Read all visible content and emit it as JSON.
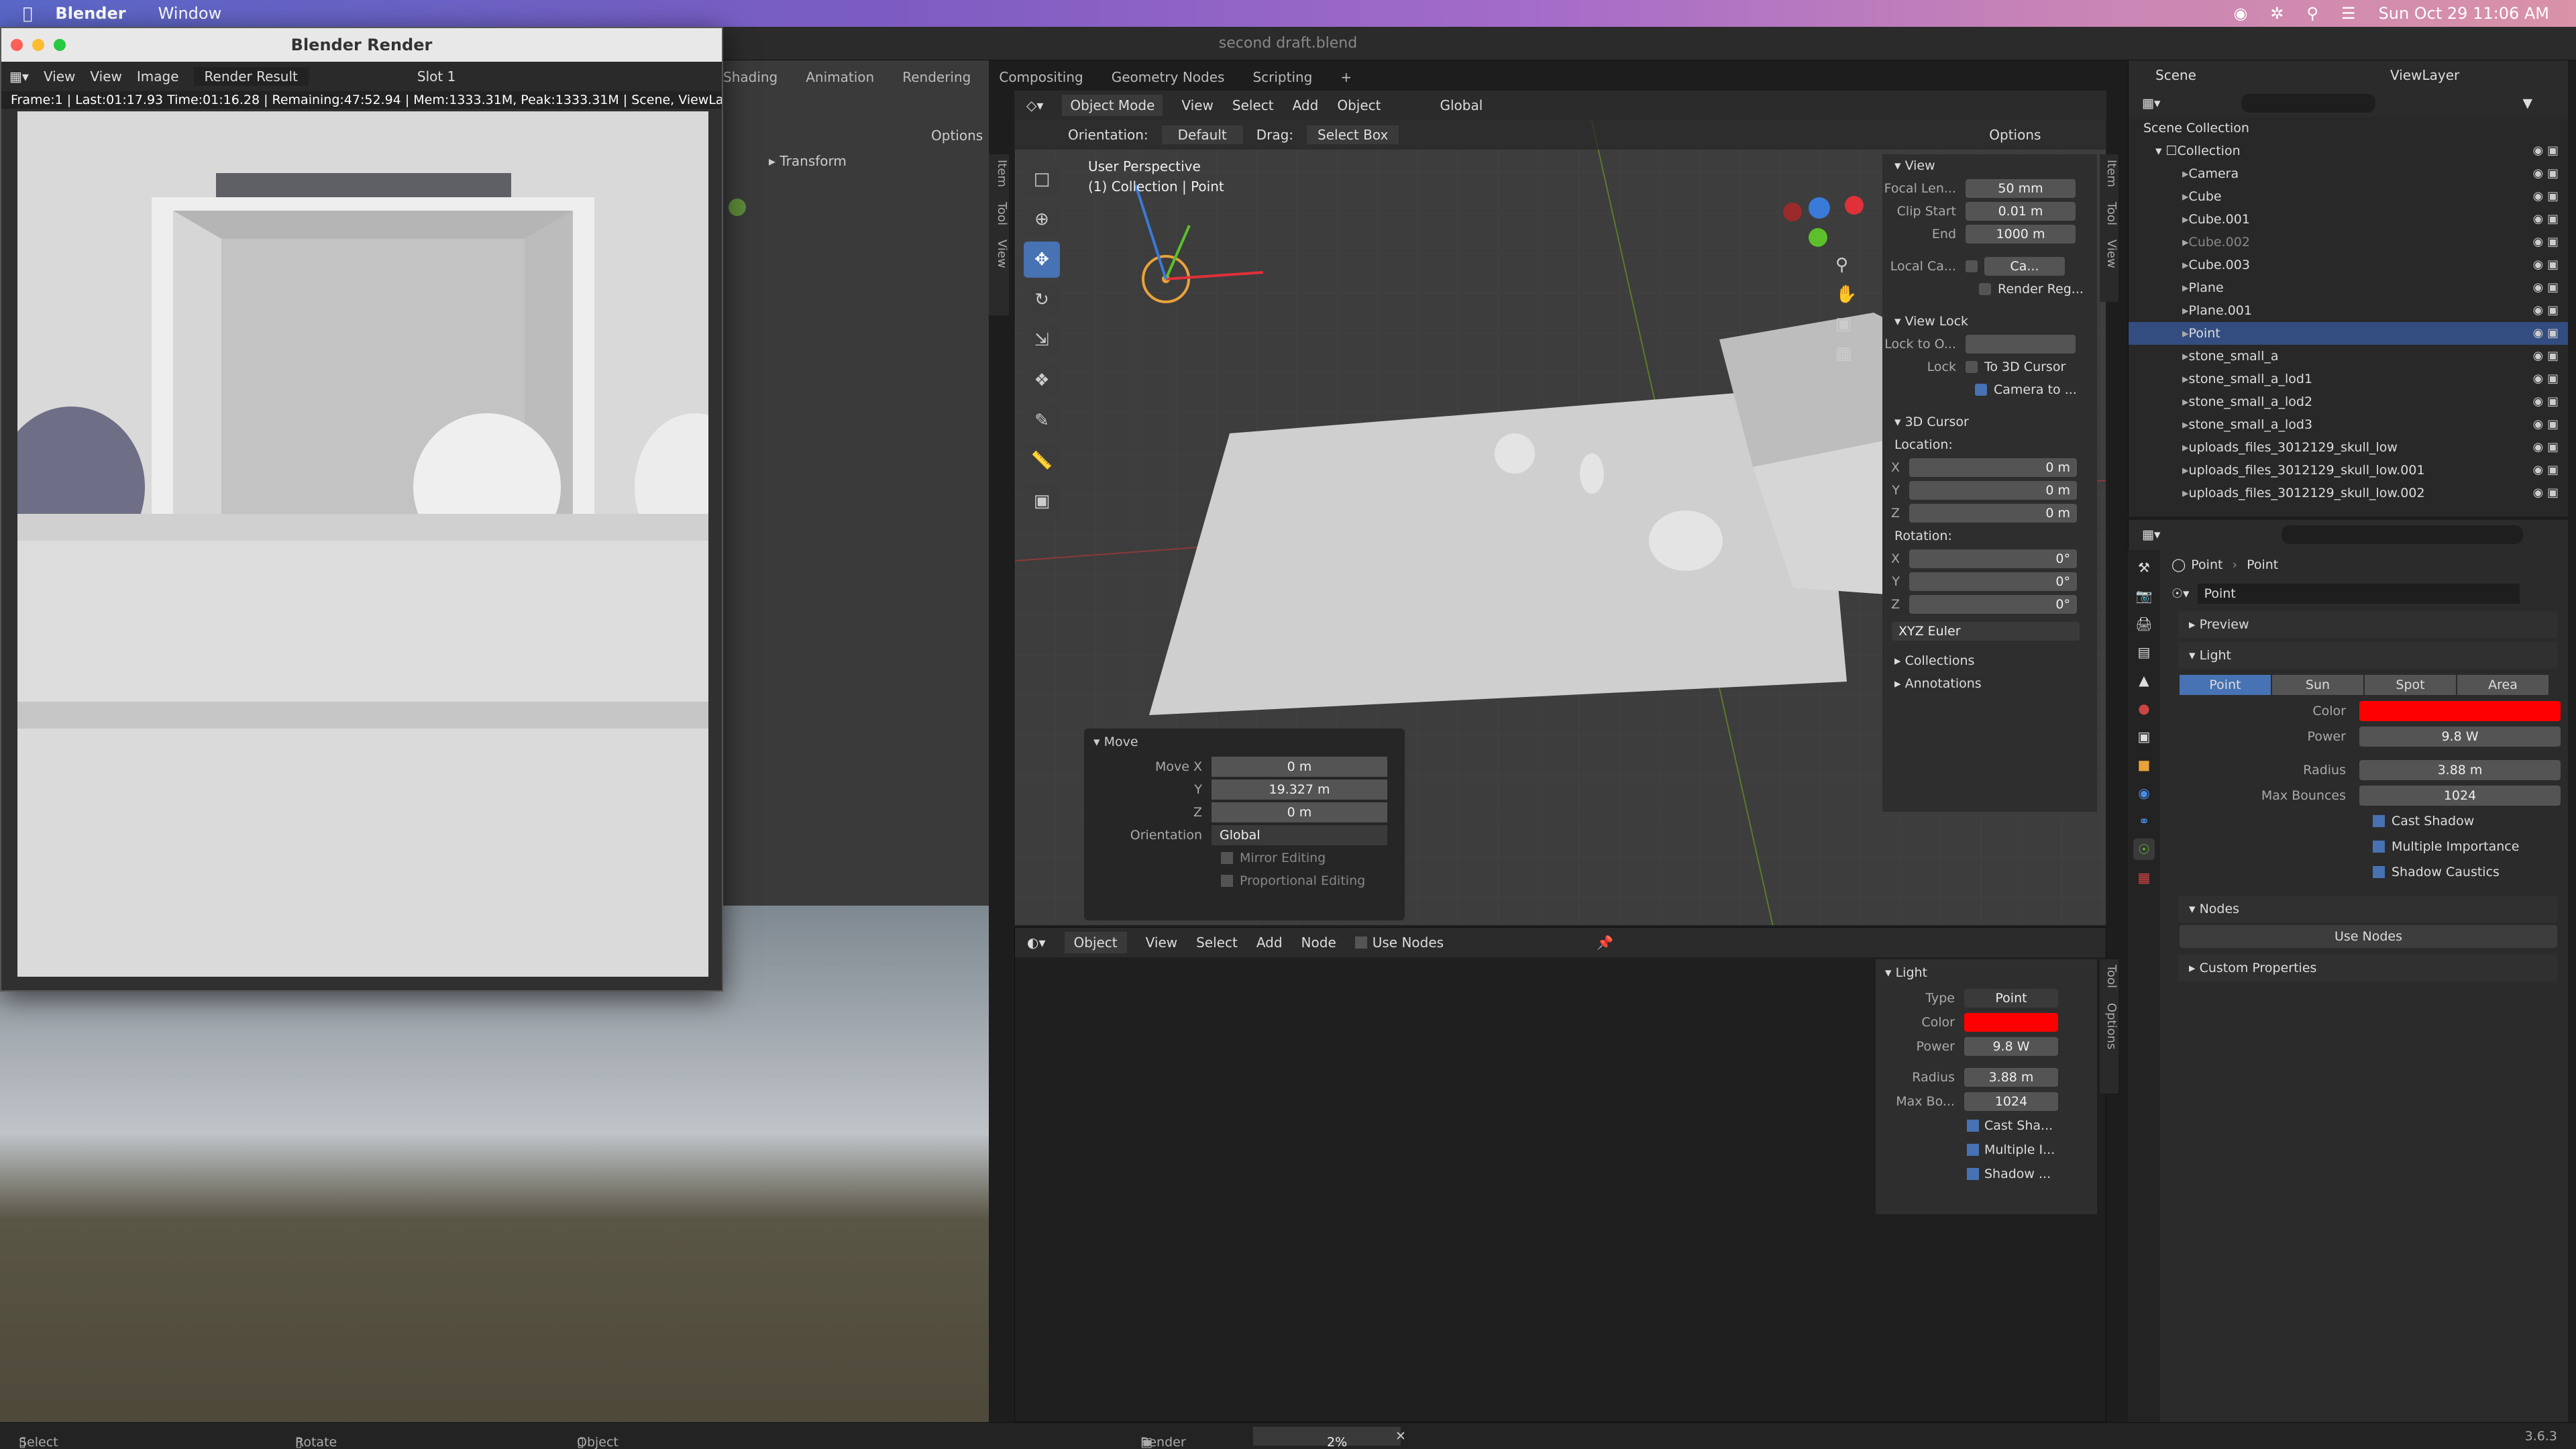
{
  "menubar": {
    "app": "Blender",
    "menu": "Window",
    "datetime": "Sun Oct 29  11:06 AM"
  },
  "titlebar": {
    "title": "second draft.blend"
  },
  "render_window": {
    "title": "Blender Render",
    "menu": [
      "View",
      "View",
      "Image"
    ],
    "image_name": "Render Result",
    "slot": "Slot 1",
    "status": "Frame:1 | Last:01:17.93 Time:01:16.28 | Remaining:47:52.94 | Mem:1333.31M, Peak:1333.31M | Scene, ViewLaye"
  },
  "left_panel": {
    "options": "Options",
    "transform": "Transform",
    "tabs": [
      "Item",
      "Tool",
      "View"
    ]
  },
  "workspaces": [
    "Shading",
    "Animation",
    "Rendering",
    "Compositing",
    "Geometry Nodes",
    "Scripting"
  ],
  "viewport": {
    "mode": "Object Mode",
    "menus": [
      "View",
      "Select",
      "Add",
      "Object"
    ],
    "transform_orientation": "Global",
    "orientation_label": "Orientation:",
    "orientation_value": "Default",
    "drag_label": "Drag:",
    "drag_value": "Select Box",
    "options": "Options",
    "overlay_title": "User Perspective",
    "overlay_sub": "(1) Collection | Point",
    "side_tabs": [
      "Item",
      "Tool",
      "View"
    ]
  },
  "npanel": {
    "view_header": "View",
    "focal_label": "Focal Len...",
    "focal_value": "50 mm",
    "clip_start_label": "Clip Start",
    "clip_start_value": "0.01 m",
    "end_label": "End",
    "end_value": "1000 m",
    "local_camera_label": "Local Ca...",
    "local_camera_value": "Ca...",
    "render_region": "Render Reg...",
    "view_lock_header": "View Lock",
    "lock_obj_label": "Lock to O...",
    "lock_label": "Lock",
    "to_3d_cursor": "To 3D Cursor",
    "camera_to": "Camera to ...",
    "cursor_header": "3D Cursor",
    "location_label": "Location:",
    "loc_x": "0 m",
    "loc_y": "0 m",
    "loc_z": "0 m",
    "rotation_label": "Rotation:",
    "rot_x": "0°",
    "rot_y": "0°",
    "rot_z": "0°",
    "rot_mode": "XYZ Euler",
    "collections": "Collections",
    "annotations": "Annotations"
  },
  "move_panel": {
    "title": "Move",
    "move_x_label": "Move X",
    "move_x": "0 m",
    "y_label": "Y",
    "move_y": "19.327 m",
    "z_label": "Z",
    "move_z": "0 m",
    "orientation_label": "Orientation",
    "orientation_value": "Global",
    "mirror": "Mirror Editing",
    "proportional": "Proportional Editing"
  },
  "shader": {
    "type": "Object",
    "menus": [
      "View",
      "Select",
      "Add",
      "Node"
    ],
    "use_nodes": "Use Nodes",
    "side_tabs": [
      "Tool",
      "Options"
    ],
    "light_header": "Light",
    "type_label": "Type",
    "type_value": "Point",
    "color_label": "Color",
    "power_label": "Power",
    "power_value": "9.8 W",
    "radius_label": "Radius",
    "radius_value": "3.88 m",
    "max_bounces_label": "Max Bo...",
    "max_bounces_value": "1024",
    "cast_shadow": "Cast Sha...",
    "multiple_imp": "Multiple I...",
    "shadow_caustics": "Shadow ..."
  },
  "outliner": {
    "scene": "Scene",
    "view_layer": "ViewLayer",
    "root": "Scene Collection",
    "collection": "Collection",
    "items": [
      {
        "name": "Camera"
      },
      {
        "name": "Cube"
      },
      {
        "name": "Cube.001"
      },
      {
        "name": "Cube.002"
      },
      {
        "name": "Cube.003"
      },
      {
        "name": "Plane"
      },
      {
        "name": "Plane.001"
      },
      {
        "name": "Point"
      },
      {
        "name": "stone_small_a"
      },
      {
        "name": "stone_small_a_lod1"
      },
      {
        "name": "stone_small_a_lod2"
      },
      {
        "name": "stone_small_a_lod3"
      },
      {
        "name": "uploads_files_3012129_skull_low"
      },
      {
        "name": "uploads_files_3012129_skull_low.001"
      },
      {
        "name": "uploads_files_3012129_skull_low.002"
      }
    ]
  },
  "properties": {
    "breadcrumb_1": "Point",
    "breadcrumb_2": "Point",
    "data_name": "Point",
    "preview": "Preview",
    "light": "Light",
    "light_types": [
      "Point",
      "Sun",
      "Spot",
      "Area"
    ],
    "color_label": "Color",
    "color_value": "#ff0000",
    "power_label": "Power",
    "power_value": "9.8 W",
    "radius_label": "Radius",
    "radius_value": "3.88 m",
    "max_bounces_label": "Max Bounces",
    "max_bounces_value": "1024",
    "cast_shadow": "Cast Shadow",
    "multiple_importance": "Multiple Importance",
    "shadow_caustics": "Shadow Caustics",
    "nodes": "Nodes",
    "use_nodes": "Use Nodes",
    "custom_properties": "Custom Properties"
  },
  "statusbar": {
    "select": "Select",
    "rotate": "Rotate View",
    "context": "Object Context Menu",
    "render": "Render",
    "progress": "2%",
    "version": "3.6.3"
  },
  "colors": {
    "accent": "#4772b3",
    "light_color": "#ff0000",
    "selected_row": "#334d80"
  }
}
